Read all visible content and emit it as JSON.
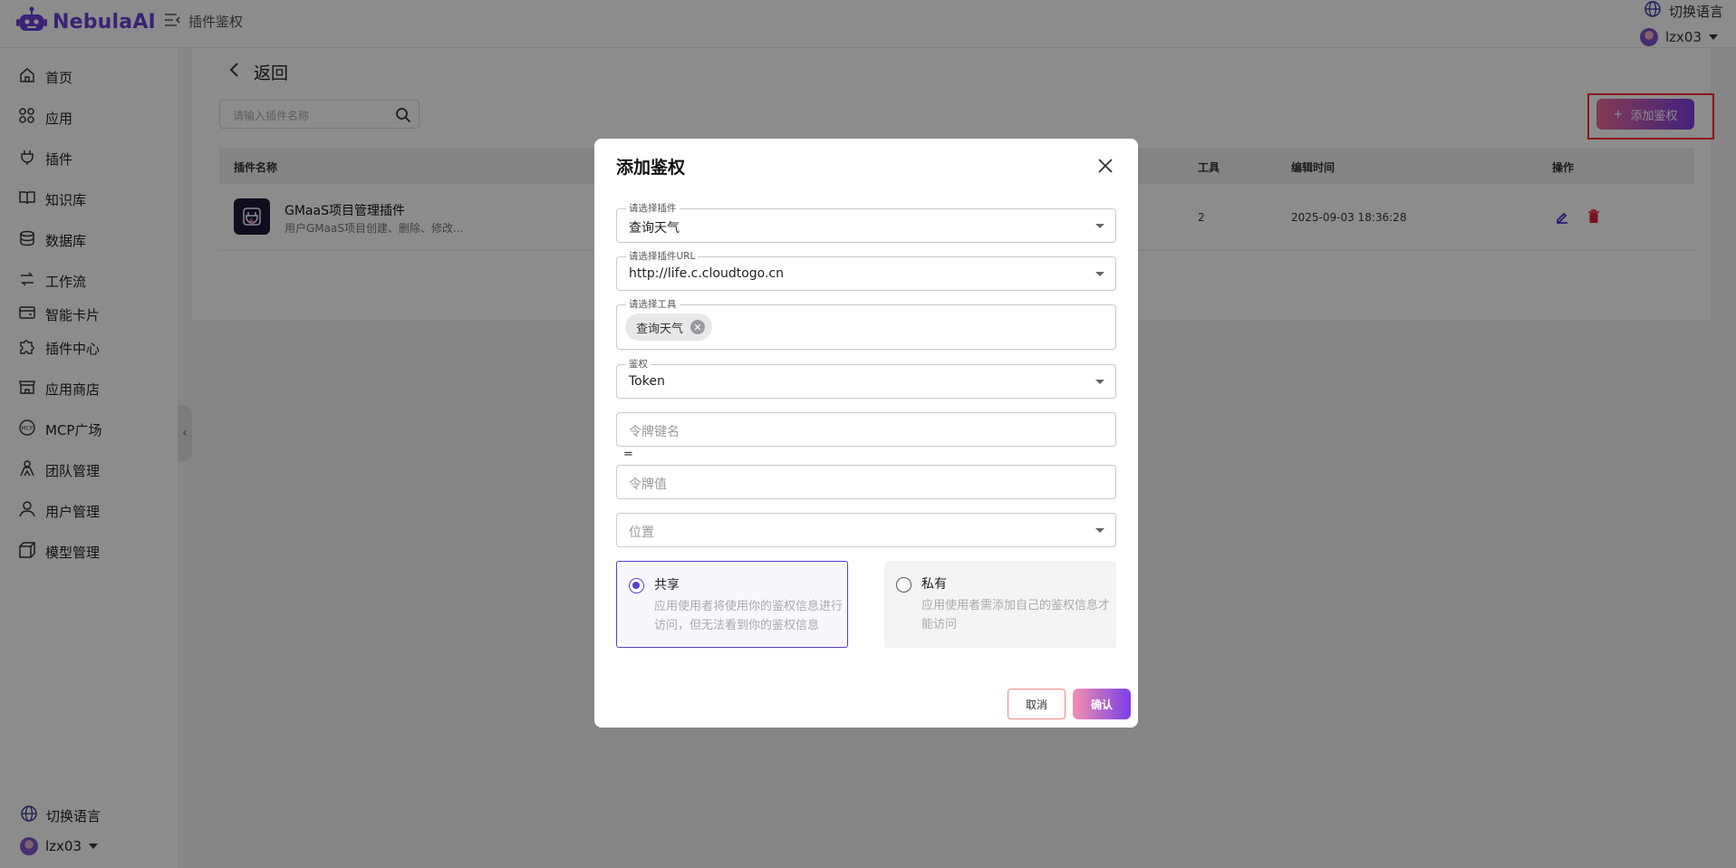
{
  "app": {
    "logo_text": "NebulaAI",
    "breadcrumb": "插件鉴权"
  },
  "header": {
    "language_label": "切换语言",
    "username": "lzx03"
  },
  "sidebar": {
    "items": [
      {
        "label": "首页",
        "icon": "home-icon"
      },
      {
        "label": "应用",
        "icon": "apps-icon"
      },
      {
        "label": "插件",
        "icon": "plug-icon"
      },
      {
        "label": "知识库",
        "icon": "book-icon"
      },
      {
        "label": "数据库",
        "icon": "database-icon"
      },
      {
        "label": "工作流",
        "icon": "workflow-icon"
      },
      {
        "label": "智能卡片",
        "icon": "card-icon"
      },
      {
        "label": "插件中心",
        "icon": "puzzle-icon"
      },
      {
        "label": "应用商店",
        "icon": "store-icon"
      },
      {
        "label": "MCP广场",
        "icon": "mcp-icon"
      },
      {
        "label": "团队管理",
        "icon": "team-icon"
      },
      {
        "label": "用户管理",
        "icon": "user-icon"
      },
      {
        "label": "模型管理",
        "icon": "cube-icon"
      }
    ],
    "language_label": "切换语言",
    "username": "lzx03"
  },
  "page": {
    "back_label": "返回",
    "search_placeholder": "请输入插件名称",
    "add_button": "添加鉴权",
    "table": {
      "headers": {
        "name": "插件名称",
        "tools": "工具",
        "edited": "编辑时间",
        "actions": "操作"
      },
      "rows": [
        {
          "name": "GMaaS项目管理插件",
          "desc": "用户GMaaS项目创建、删除、修改...",
          "tools": "2",
          "edited": "2025-09-03 18:36:28"
        }
      ]
    }
  },
  "dialog": {
    "title": "添加鉴权",
    "plugin": {
      "label": "请选择插件",
      "value": "查询天气"
    },
    "url": {
      "label": "请选择插件URL",
      "value": "http://life.c.cloudtogo.cn"
    },
    "tools": {
      "label": "请选择工具",
      "chips": [
        "查询天气"
      ]
    },
    "auth": {
      "label": "鉴权",
      "value": "Token"
    },
    "token_key_placeholder": "令牌键名",
    "equals": "=",
    "token_value_placeholder": "令牌值",
    "position_placeholder": "位置",
    "options": {
      "shared": {
        "title": "共享",
        "desc": "应用使用者将使用你的鉴权信息进行访问，但无法看到你的鉴权信息",
        "selected": true
      },
      "private": {
        "title": "私有",
        "desc": "应用使用者需添加自己的鉴权信息才能访问",
        "selected": false
      }
    },
    "cancel": "取消",
    "confirm": "确认"
  },
  "colors": {
    "accent": "#5b3fc9",
    "brand": "#6a3fd6",
    "gradient_start": "#f06a9a",
    "gradient_end": "#7b3fe4",
    "danger": "#e0223a"
  }
}
